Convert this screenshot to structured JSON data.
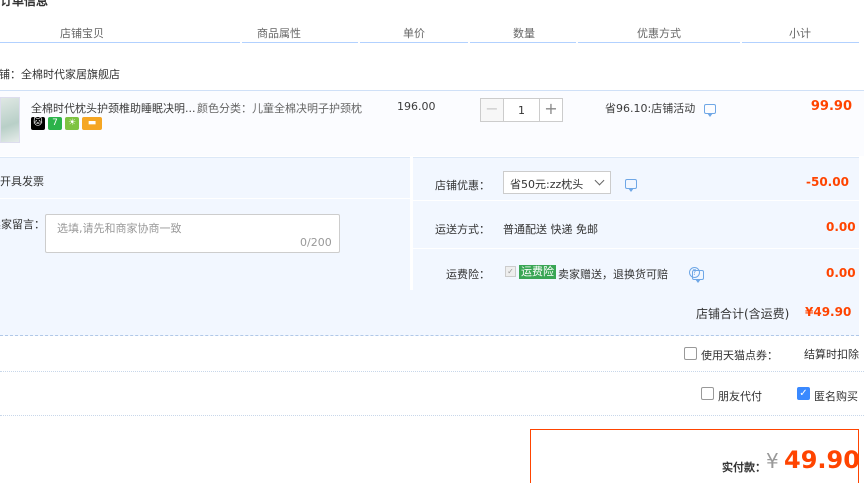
{
  "section_title": "订单信息",
  "headers": {
    "shop_item": "店铺宝贝",
    "attributes": "商品属性",
    "unit_price": "单价",
    "quantity": "数量",
    "discount": "优惠方式",
    "subtotal": "小计"
  },
  "shop": {
    "label": "店铺：全棉时代家居旗舰店"
  },
  "item": {
    "title": "全棉时代枕头护颈椎助睡眠决明...",
    "sku": "颜色分类：儿童全棉决明子护颈枕",
    "price": "196.00",
    "quantity": "1",
    "promo": "省96.10:店铺活动",
    "subtotal": "99.90",
    "badges": [
      "tmall-cat-icon",
      "seven-day-return-icon",
      "bulb-icon",
      "card-icon"
    ]
  },
  "invoice": {
    "label": "开具发票"
  },
  "message": {
    "label": "卖家留言：",
    "placeholder": "选填,请先和商家协商一致",
    "count": "0/200"
  },
  "coupon": {
    "label": "店铺优惠：",
    "selected": "省50元:zz枕头",
    "value": "-50.00"
  },
  "shipping": {
    "label": "运送方式：",
    "method": "普通配送 快递 免邮",
    "value": "0.00"
  },
  "insurance": {
    "label": "运费险：",
    "tag": "运费险",
    "desc": "卖家赠送，退换货可赔",
    "value": "0.00"
  },
  "shop_total": {
    "label": "店铺合计(含运费)",
    "value": "¥49.90"
  },
  "points": {
    "label": "使用天猫点券：",
    "note": "结算时扣除"
  },
  "options": {
    "friend_pay": "朋友代付",
    "anonymous": "匿名购买"
  },
  "payment": {
    "label": "实付款：",
    "currency": "¥",
    "value": "49.90"
  },
  "colors": {
    "accent_red": "#ff4400",
    "link_blue": "#3a89ff",
    "panel_bg": "#f2f7ff"
  }
}
